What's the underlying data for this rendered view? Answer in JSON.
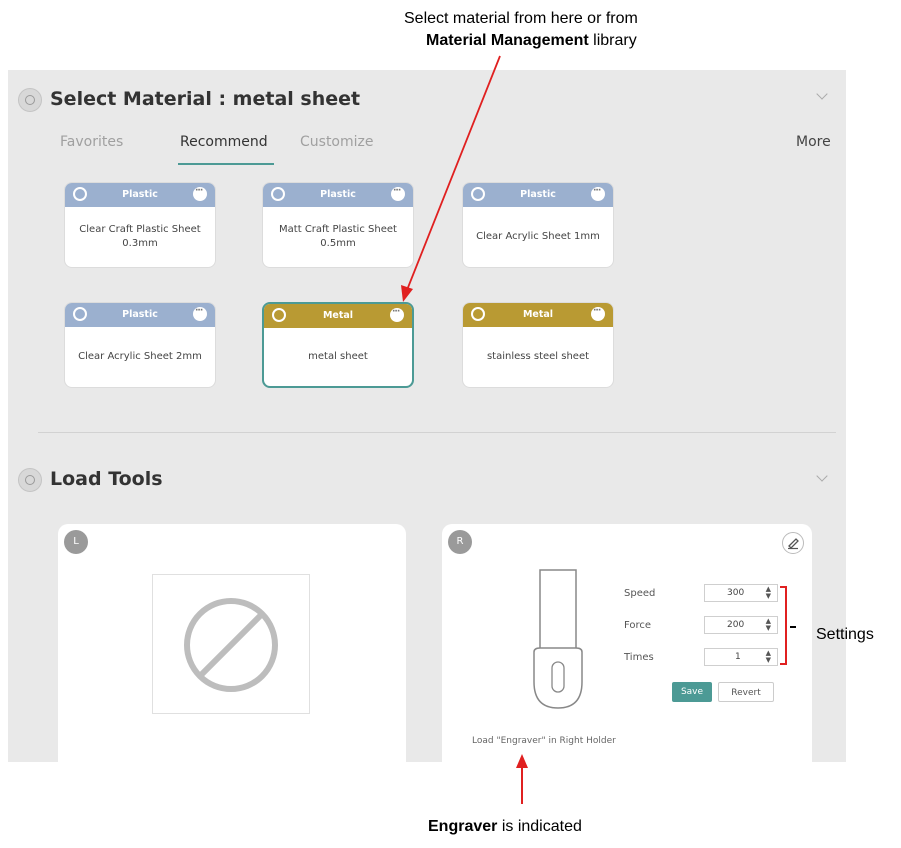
{
  "annotations": {
    "top_line1": "Select material from  here or from",
    "top_line2_bold": "Material Management",
    "top_line2_rest": "library",
    "settings": "Settings",
    "bottom_bold": "Engraver",
    "bottom_rest": "is indicated"
  },
  "material_section": {
    "title": "Select Material : metal sheet",
    "tabs": [
      "Favorites",
      "Recommend",
      "Customize"
    ],
    "active_tab": "Recommend",
    "more": "More",
    "cards": [
      {
        "category": "Plastic",
        "name": "Clear Craft Plastic Sheet 0.3mm"
      },
      {
        "category": "Plastic",
        "name": "Matt Craft Plastic Sheet 0.5mm"
      },
      {
        "category": "Plastic",
        "name": "Clear Acrylic Sheet 1mm"
      },
      {
        "category": "Plastic",
        "name": "Clear Acrylic Sheet 2mm"
      },
      {
        "category": "Metal",
        "name": "metal sheet",
        "selected": true
      },
      {
        "category": "Metal",
        "name": "stainless steel sheet"
      }
    ]
  },
  "load_tools": {
    "title": "Load Tools",
    "left_holder": {
      "badge": "L",
      "icon": "no-tool-icon"
    },
    "right_holder": {
      "badge": "R",
      "speed_label": "Speed",
      "speed_value": "300",
      "force_label": "Force",
      "force_value": "200",
      "times_label": "Times",
      "times_value": "1",
      "save": "Save",
      "revert": "Revert",
      "load_text": "Load \"Engraver\" in Right Holder"
    }
  },
  "colors": {
    "plastic_header": "#9bb0cf",
    "metal_header": "#b99a33",
    "accent_teal": "#4c9a95",
    "annotation_arrow": "#e02020"
  }
}
